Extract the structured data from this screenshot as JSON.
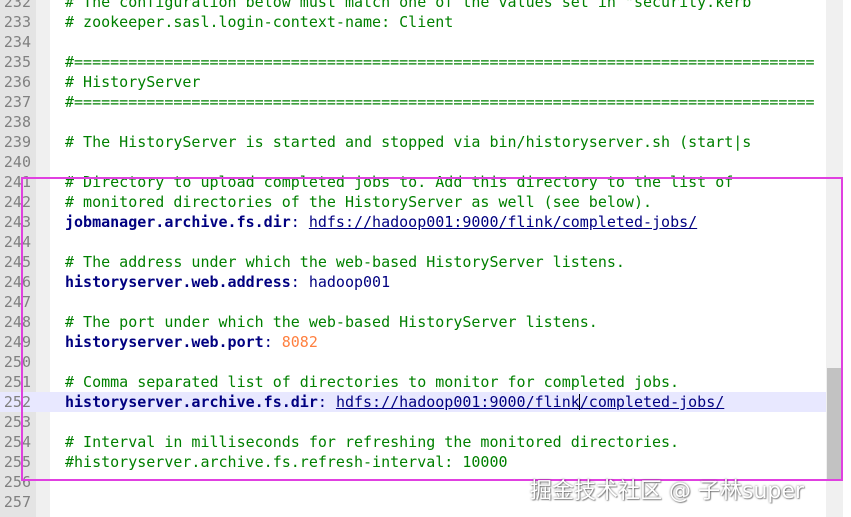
{
  "editor": {
    "lines": [
      {
        "n": "232",
        "type": "comment",
        "text": "# The configuration below must match one of the values set in \"security.kerb"
      },
      {
        "n": "233",
        "type": "comment",
        "text": "# zookeeper.sasl.login-context-name: Client"
      },
      {
        "n": "234",
        "type": "blank",
        "text": ""
      },
      {
        "n": "235",
        "type": "comment",
        "text": "#=================================================================================="
      },
      {
        "n": "236",
        "type": "comment",
        "text": "# HistoryServer"
      },
      {
        "n": "237",
        "type": "comment",
        "text": "#=================================================================================="
      },
      {
        "n": "238",
        "type": "blank",
        "text": ""
      },
      {
        "n": "239",
        "type": "comment",
        "text": "# The HistoryServer is started and stopped via bin/historyserver.sh (start|s"
      },
      {
        "n": "240",
        "type": "blank",
        "text": ""
      },
      {
        "n": "241",
        "type": "comment",
        "text": "# Directory to upload completed jobs to. Add this directory to the list of"
      },
      {
        "n": "242",
        "type": "comment",
        "text": "# monitored directories of the HistoryServer as well (see below)."
      },
      {
        "n": "243",
        "type": "kv",
        "key": "jobmanager.archive.fs.dir",
        "sep": ": ",
        "value": "hdfs://hadoop001:9000/flink/completed-jobs/",
        "vtype": "url"
      },
      {
        "n": "244",
        "type": "blank",
        "text": ""
      },
      {
        "n": "245",
        "type": "comment",
        "text": "# The address under which the web-based HistoryServer listens."
      },
      {
        "n": "246",
        "type": "kv",
        "key": "historyserver.web.address",
        "sep": ": ",
        "value": "hadoop001",
        "vtype": "val"
      },
      {
        "n": "247",
        "type": "blank",
        "text": ""
      },
      {
        "n": "248",
        "type": "comment",
        "text": "# The port under which the web-based HistoryServer listens."
      },
      {
        "n": "249",
        "type": "kv",
        "key": "historyserver.web.port",
        "sep": ": ",
        "value": "8082",
        "vtype": "num"
      },
      {
        "n": "250",
        "type": "blank",
        "text": ""
      },
      {
        "n": "251",
        "type": "comment",
        "text": "# Comma separated list of directories to monitor for completed jobs."
      },
      {
        "n": "252",
        "type": "kv",
        "key": "historyserver.archive.fs.dir",
        "sep": ": ",
        "value": "hdfs://hadoop001:9000/flink/completed-jobs/",
        "vtype": "url",
        "current": true,
        "caret_after": "hdfs://hadoop001:9000/flink"
      },
      {
        "n": "253",
        "type": "blank",
        "text": ""
      },
      {
        "n": "254",
        "type": "comment",
        "text": "# Interval in milliseconds for refreshing the monitored directories."
      },
      {
        "n": "255",
        "type": "comment",
        "text": "#historyserver.archive.fs.refresh-interval: 10000"
      },
      {
        "n": "256",
        "type": "blank",
        "text": ""
      },
      {
        "n": "257",
        "type": "blank",
        "text": ""
      }
    ]
  },
  "watermark": "掘金技术社区 @ 子林super",
  "colors": {
    "comment": "#008000",
    "key": "#000080",
    "number": "#ff8040",
    "highlight_box": "#e040e0",
    "current_line": "#e8e8ff",
    "gutter": "#e4e4e4"
  }
}
